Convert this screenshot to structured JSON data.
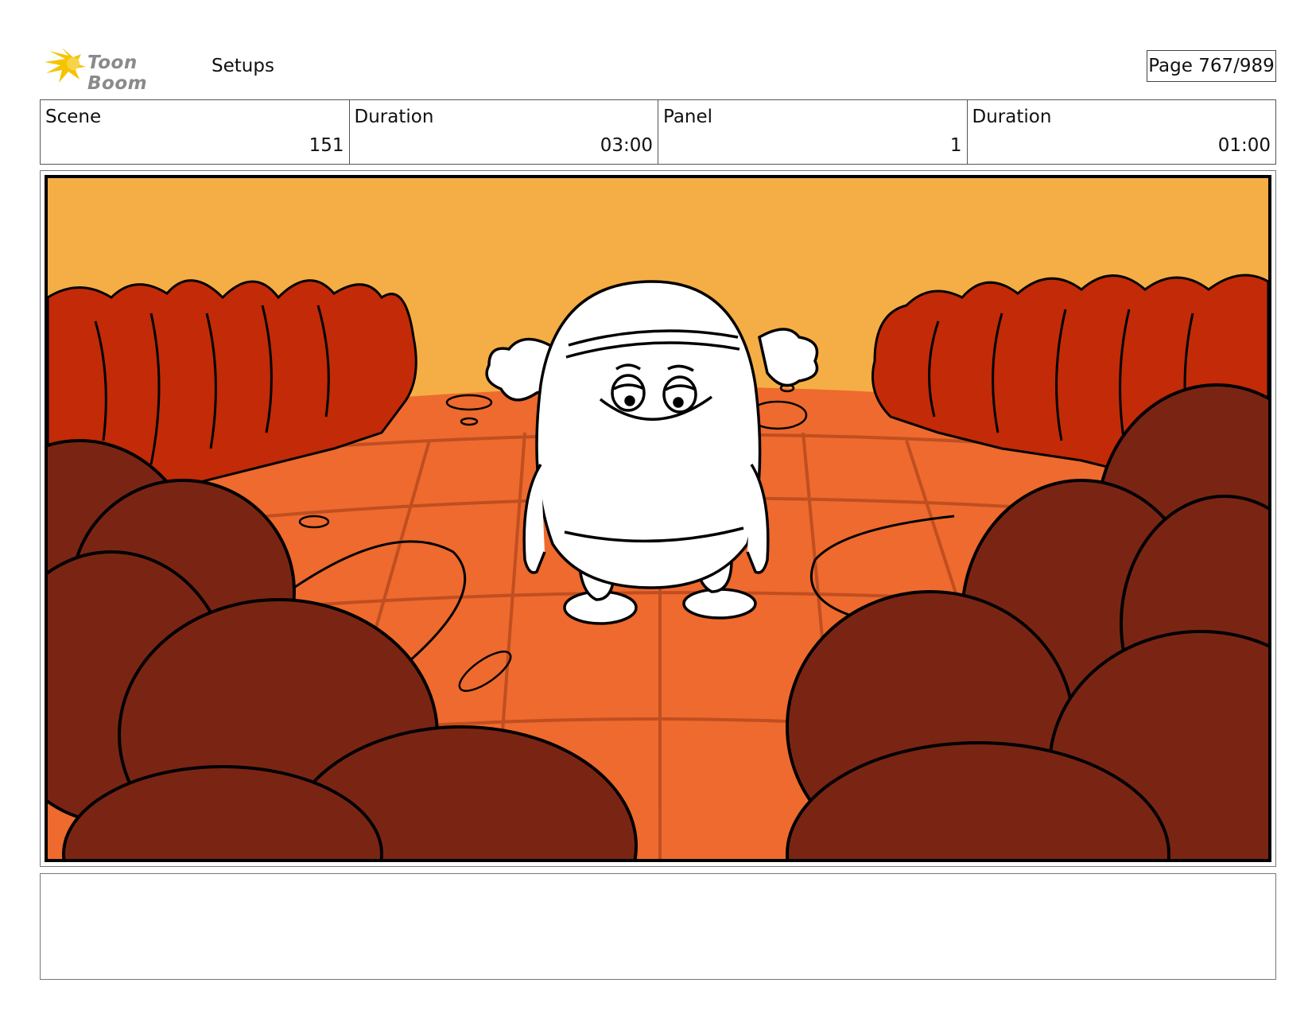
{
  "header": {
    "logo_text": "Toon Boom",
    "section_title": "Setups",
    "page_label": "Page 767/989"
  },
  "info": [
    {
      "label": "Scene",
      "value": "151"
    },
    {
      "label": "Duration",
      "value": "03:00"
    },
    {
      "label": "Panel",
      "value": "1"
    },
    {
      "label": "Duration",
      "value": "01:00"
    }
  ],
  "panel": {
    "description_icon": "storyboard-illustration",
    "colors": {
      "sky": "#f5ae45",
      "ground": "#ee6a2e",
      "grid_lines": "#b84a1e",
      "far_bushes": "#c22a08",
      "near_rocks": "#7a2513",
      "character": "#ffffff",
      "outline": "#000000"
    }
  },
  "notes": {
    "text": ""
  }
}
